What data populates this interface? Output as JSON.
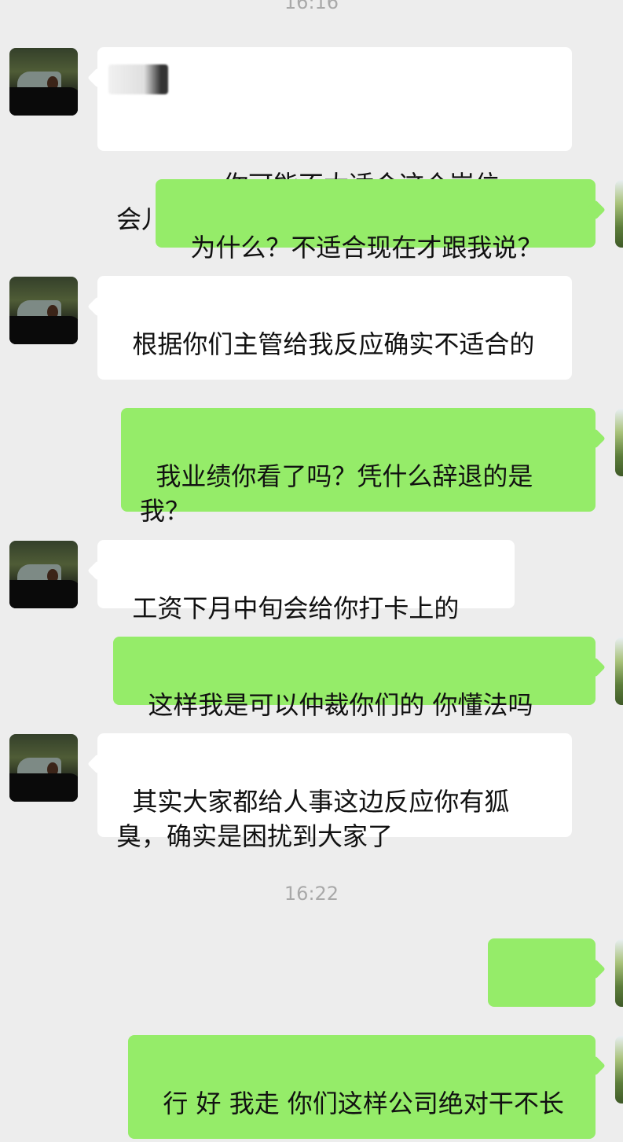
{
  "timestamps": [
    "16:16",
    "16:22"
  ],
  "messages": [
    {
      "side": "left",
      "text": "，你可能不太适合这个岗位，一会儿下了班，来办下离职手续吧",
      "redacted_name": true
    },
    {
      "side": "right",
      "text": "为什么？不适合现在才跟我说？"
    },
    {
      "side": "left",
      "text": "根据你们主管给我反应确实不适合的"
    },
    {
      "side": "right",
      "text": "我业绩你看了吗？凭什么辞退的是我？"
    },
    {
      "side": "left",
      "text": "工资下月中旬会给你打卡上的"
    },
    {
      "side": "right",
      "text": "这样我是可以仲裁你们的 你懂法吗"
    },
    {
      "side": "left",
      "text": "其实大家都给人事这边反应你有狐臭，确实是困扰到大家了"
    },
    {
      "side": "right",
      "text": "………"
    },
    {
      "side": "right",
      "text": "行 好 我走 你们这样公司绝对干不长"
    }
  ],
  "colors": {
    "background": "#ededed",
    "bubble_left": "#ffffff",
    "bubble_right": "#95ec69",
    "timestamp": "#a9a9a9"
  }
}
